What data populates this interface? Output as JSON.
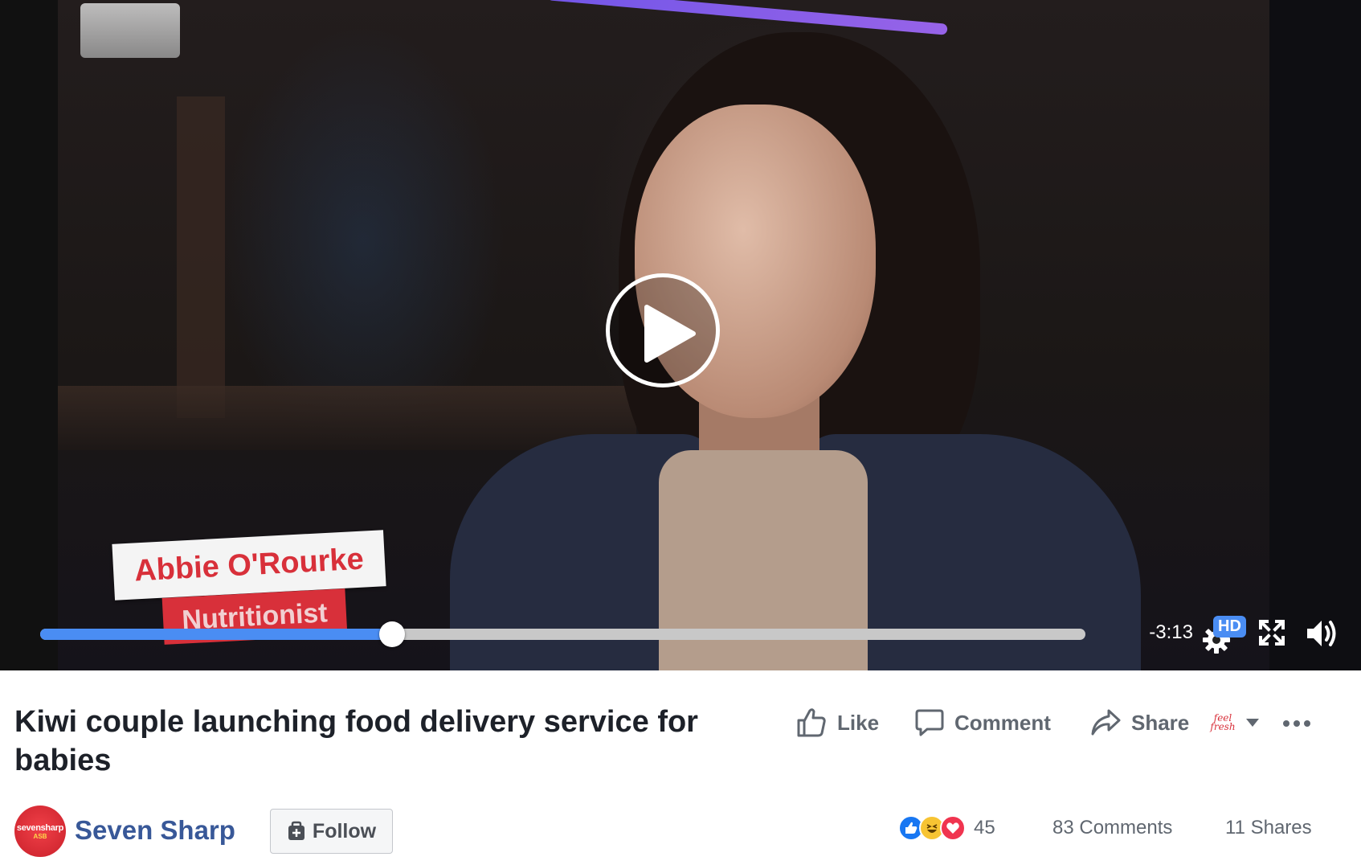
{
  "video": {
    "lower_third": {
      "name": "Abbie O'Rourke",
      "role": "Nutritionist"
    },
    "controls": {
      "progress": 0.337,
      "time_remaining": "-3:13",
      "quality_badge": "HD",
      "icons": [
        "play-icon",
        "settings-gear-icon",
        "fullscreen-icon",
        "volume-icon"
      ]
    }
  },
  "post": {
    "title": "Kiwi couple launching food delivery service for babies",
    "actions": {
      "like": "Like",
      "comment": "Comment",
      "share": "Share"
    },
    "brand_selector": "feel fresh",
    "page": {
      "name": "Seven Sharp",
      "avatar_text": "sevensharp",
      "avatar_sub": "ASB",
      "follow_label": "Follow"
    },
    "stats": {
      "reactions_count": "45",
      "comments": "83 Comments",
      "shares": "11 Shares"
    }
  },
  "colors": {
    "accent": "#4a8df3",
    "brand": "#385898",
    "lower_third_red": "#d8303a"
  }
}
